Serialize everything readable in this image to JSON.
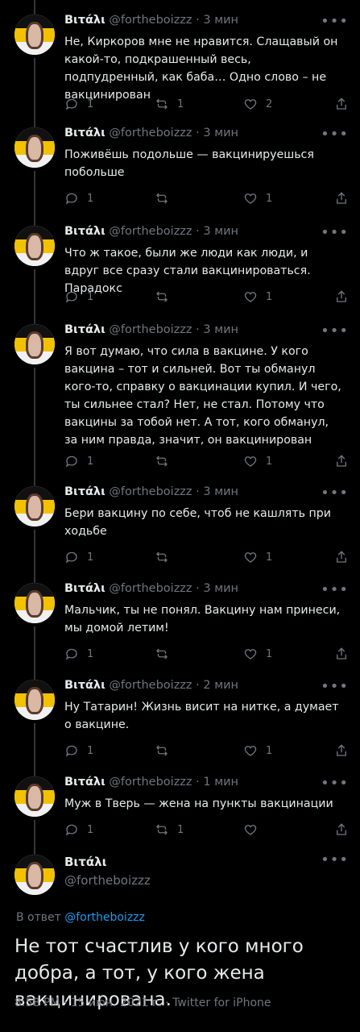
{
  "tweets": [
    {
      "name": "Βιτάλι",
      "handle": "@fortheboizzz",
      "time": "3 мин",
      "text": "Не, Киркоров мне не нравится. Слащавый он какой-то, подкрашенный весь, подпудренный, как баба… Одно слово – не вакцинирован",
      "replies": "1",
      "retweets": "1",
      "likes": "2"
    },
    {
      "name": "Βιτάλι",
      "handle": "@fortheboizzz",
      "time": "3 мин",
      "text": "Поживёшь подольше — вакцинируешься побольше",
      "replies": "1",
      "retweets": "",
      "likes": "1"
    },
    {
      "name": "Βιτάλι",
      "handle": "@fortheboizzz",
      "time": "3 мин",
      "text": "Что ж такое, были же люди как люди, и вдруг все сразу стали вакцинироваться. Парадокс",
      "replies": "1",
      "retweets": "",
      "likes": "1"
    },
    {
      "name": "Βιτάλι",
      "handle": "@fortheboizzz",
      "time": "3 мин",
      "text": "Я вот думаю, что сила в вакцине. У кого вакцина – тот и сильней. Вот ты обманул кого-то, справку о вакцинации купил. И чего, ты сильнее стал? Нет, не стал. Потому что вакцины за тобой нет. А тот, кого обманул, за ним правда, значит, он вакцинирован",
      "replies": "1",
      "retweets": "",
      "likes": "1"
    },
    {
      "name": "Βιτάλι",
      "handle": "@fortheboizzz",
      "time": "3 мин",
      "text": "Бери вакцину по себе, чтоб не кашлять при ходьбе",
      "replies": "1",
      "retweets": "",
      "likes": "1"
    },
    {
      "name": "Βιτάλι",
      "handle": "@fortheboizzz",
      "time": "3 мин",
      "text": "Мальчик, ты не понял. Вакцину нам принеси, мы домой летим!",
      "replies": "1",
      "retweets": "",
      "likes": "1"
    },
    {
      "name": "Βιτάλι",
      "handle": "@fortheboizzz",
      "time": "2 мин",
      "text": "Ну Татарин! Жизнь висит на нитке, а думает о вакцине.",
      "replies": "1",
      "retweets": "",
      "likes": "1"
    },
    {
      "name": "Βιτάλι",
      "handle": "@fortheboizzz",
      "time": "1 мин",
      "text": "Муж в Тверь — жена на пункты вакцинации",
      "replies": "1",
      "retweets": "1",
      "likes": ""
    }
  ],
  "main": {
    "name": "Βιτάλι",
    "handle": "@fortheboizzz",
    "reply_prefix": "В ответ",
    "reply_to": "@fortheboizzz",
    "text": "Не тот счастлив у кого много добра, а тот, у кого жена вакцинирована.",
    "meta": "8:58 PM · 15 июн. 2021 г. · Twitter for iPhone"
  },
  "icons": {
    "reply": "reply-icon",
    "retweet": "retweet-icon",
    "like": "heart-icon",
    "share": "share-icon",
    "more": "more-icon"
  },
  "colors": {
    "background": "#000000",
    "text": "#e7e9ea",
    "muted": "#71767b",
    "link": "#1d9bf0"
  }
}
